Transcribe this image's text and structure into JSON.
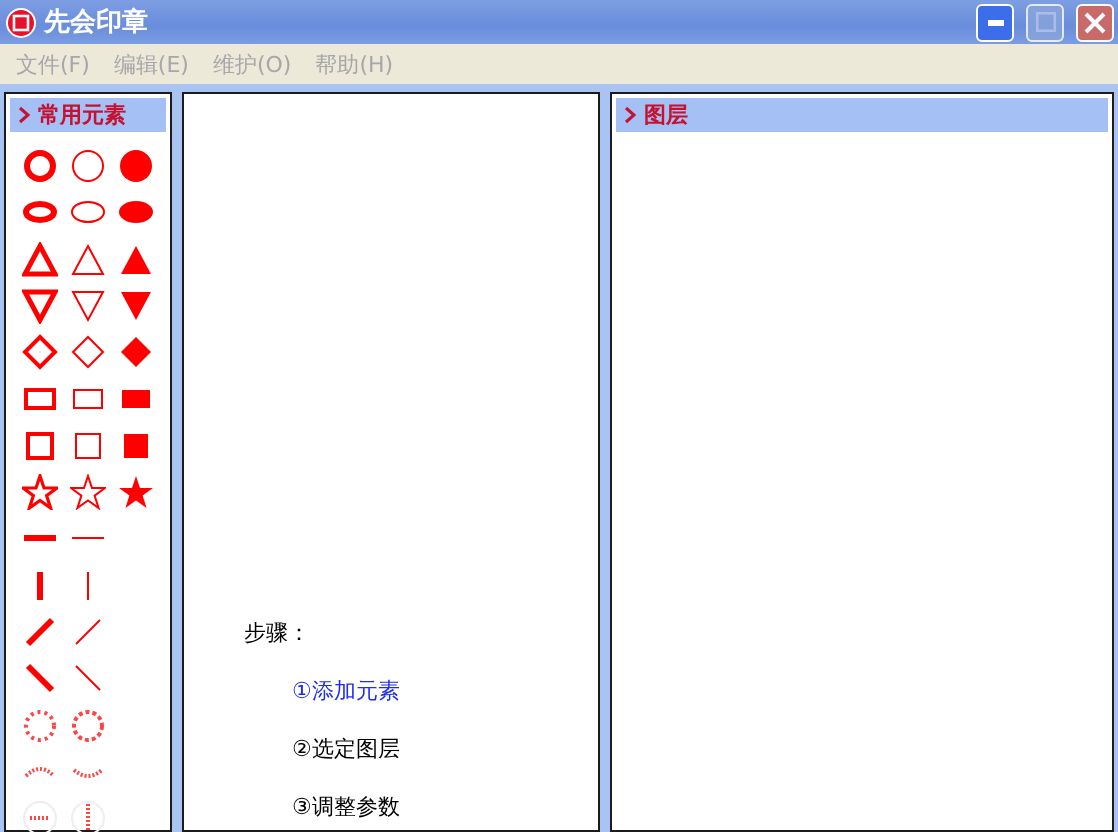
{
  "window": {
    "title": "先会印章"
  },
  "menu": [
    {
      "label": "文件(F)",
      "disabled": true
    },
    {
      "label": "编辑(E)",
      "disabled": true
    },
    {
      "label": "维护(O)",
      "disabled": true
    },
    {
      "label": "帮助(H)",
      "disabled": true
    }
  ],
  "elements_panel": {
    "title": "常用元素",
    "expanded": true
  },
  "steps": {
    "heading": "步骤：",
    "items": [
      {
        "label": "①添加元素",
        "selected": true
      },
      {
        "label": "②选定图层",
        "selected": false
      },
      {
        "label": "③调整参数",
        "selected": false
      }
    ]
  },
  "layers_panel": {
    "title": "图层",
    "expanded": true
  }
}
